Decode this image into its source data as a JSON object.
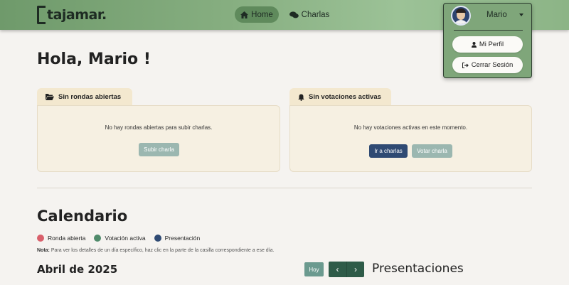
{
  "header": {
    "logo_text": "tajamar.",
    "nav": [
      {
        "label": "Home",
        "icon": "home-icon"
      },
      {
        "label": "Charlas",
        "icon": "chat-bubbles-icon"
      }
    ]
  },
  "user_menu": {
    "name": "Mario",
    "items": [
      {
        "label": "Mi Perfil",
        "icon": "user-icon"
      },
      {
        "label": "Cerrar Sesión",
        "icon": "logout-icon"
      }
    ]
  },
  "greeting": "Hola, Mario !",
  "cards": [
    {
      "tab_label": "Sin rondas abiertas",
      "icon": "folder-open-icon",
      "message": "No hay rondas abiertas para subir charlas.",
      "buttons": [
        "Subir charla"
      ]
    },
    {
      "tab_label": "Sin votaciones activas",
      "icon": "bell-icon",
      "message": "No hay votaciones activas en este momento.",
      "buttons": [
        "Ir a charlas",
        "Votar charla"
      ]
    }
  ],
  "calendar": {
    "title": "Calendario",
    "legend": [
      {
        "label": "Ronda abierta",
        "color": "#d9606b"
      },
      {
        "label": "Votación activa",
        "color": "#4f8a6a"
      },
      {
        "label": "Presentación",
        "color": "#2f4a73"
      }
    ],
    "note_bold": "Nota:",
    "note_text": " Para ver los detalles de un día específico, haz clic en la parte de la casilla correspondiente a ese día.",
    "month": "Abril de 2025",
    "today_label": "Hoy",
    "prev_label": "‹",
    "next_label": "›",
    "side_title": "Presentaciones"
  },
  "colors": {
    "header": "#86ae80",
    "card_bg": "#f6f0e2",
    "primary_btn": "#2f4a73",
    "disabled_btn": "#9bb7b0"
  }
}
